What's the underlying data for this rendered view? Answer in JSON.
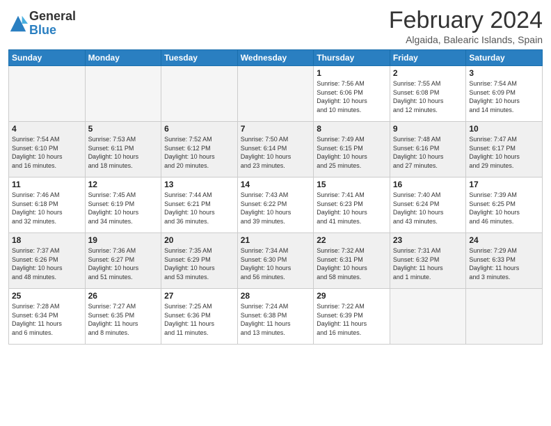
{
  "header": {
    "logo": {
      "general": "General",
      "blue": "Blue"
    },
    "title": "February 2024",
    "location": "Algaida, Balearic Islands, Spain"
  },
  "days_of_week": [
    "Sunday",
    "Monday",
    "Tuesday",
    "Wednesday",
    "Thursday",
    "Friday",
    "Saturday"
  ],
  "weeks": [
    [
      {
        "day": "",
        "info": "",
        "empty": true
      },
      {
        "day": "",
        "info": "",
        "empty": true
      },
      {
        "day": "",
        "info": "",
        "empty": true
      },
      {
        "day": "",
        "info": "",
        "empty": true
      },
      {
        "day": "1",
        "info": "Sunrise: 7:56 AM\nSunset: 6:06 PM\nDaylight: 10 hours\nand 10 minutes."
      },
      {
        "day": "2",
        "info": "Sunrise: 7:55 AM\nSunset: 6:08 PM\nDaylight: 10 hours\nand 12 minutes."
      },
      {
        "day": "3",
        "info": "Sunrise: 7:54 AM\nSunset: 6:09 PM\nDaylight: 10 hours\nand 14 minutes."
      }
    ],
    [
      {
        "day": "4",
        "info": "Sunrise: 7:54 AM\nSunset: 6:10 PM\nDaylight: 10 hours\nand 16 minutes."
      },
      {
        "day": "5",
        "info": "Sunrise: 7:53 AM\nSunset: 6:11 PM\nDaylight: 10 hours\nand 18 minutes."
      },
      {
        "day": "6",
        "info": "Sunrise: 7:52 AM\nSunset: 6:12 PM\nDaylight: 10 hours\nand 20 minutes."
      },
      {
        "day": "7",
        "info": "Sunrise: 7:50 AM\nSunset: 6:14 PM\nDaylight: 10 hours\nand 23 minutes."
      },
      {
        "day": "8",
        "info": "Sunrise: 7:49 AM\nSunset: 6:15 PM\nDaylight: 10 hours\nand 25 minutes."
      },
      {
        "day": "9",
        "info": "Sunrise: 7:48 AM\nSunset: 6:16 PM\nDaylight: 10 hours\nand 27 minutes."
      },
      {
        "day": "10",
        "info": "Sunrise: 7:47 AM\nSunset: 6:17 PM\nDaylight: 10 hours\nand 29 minutes."
      }
    ],
    [
      {
        "day": "11",
        "info": "Sunrise: 7:46 AM\nSunset: 6:18 PM\nDaylight: 10 hours\nand 32 minutes."
      },
      {
        "day": "12",
        "info": "Sunrise: 7:45 AM\nSunset: 6:19 PM\nDaylight: 10 hours\nand 34 minutes."
      },
      {
        "day": "13",
        "info": "Sunrise: 7:44 AM\nSunset: 6:21 PM\nDaylight: 10 hours\nand 36 minutes."
      },
      {
        "day": "14",
        "info": "Sunrise: 7:43 AM\nSunset: 6:22 PM\nDaylight: 10 hours\nand 39 minutes."
      },
      {
        "day": "15",
        "info": "Sunrise: 7:41 AM\nSunset: 6:23 PM\nDaylight: 10 hours\nand 41 minutes."
      },
      {
        "day": "16",
        "info": "Sunrise: 7:40 AM\nSunset: 6:24 PM\nDaylight: 10 hours\nand 43 minutes."
      },
      {
        "day": "17",
        "info": "Sunrise: 7:39 AM\nSunset: 6:25 PM\nDaylight: 10 hours\nand 46 minutes."
      }
    ],
    [
      {
        "day": "18",
        "info": "Sunrise: 7:37 AM\nSunset: 6:26 PM\nDaylight: 10 hours\nand 48 minutes."
      },
      {
        "day": "19",
        "info": "Sunrise: 7:36 AM\nSunset: 6:27 PM\nDaylight: 10 hours\nand 51 minutes."
      },
      {
        "day": "20",
        "info": "Sunrise: 7:35 AM\nSunset: 6:29 PM\nDaylight: 10 hours\nand 53 minutes."
      },
      {
        "day": "21",
        "info": "Sunrise: 7:34 AM\nSunset: 6:30 PM\nDaylight: 10 hours\nand 56 minutes."
      },
      {
        "day": "22",
        "info": "Sunrise: 7:32 AM\nSunset: 6:31 PM\nDaylight: 10 hours\nand 58 minutes."
      },
      {
        "day": "23",
        "info": "Sunrise: 7:31 AM\nSunset: 6:32 PM\nDaylight: 11 hours\nand 1 minute."
      },
      {
        "day": "24",
        "info": "Sunrise: 7:29 AM\nSunset: 6:33 PM\nDaylight: 11 hours\nand 3 minutes."
      }
    ],
    [
      {
        "day": "25",
        "info": "Sunrise: 7:28 AM\nSunset: 6:34 PM\nDaylight: 11 hours\nand 6 minutes."
      },
      {
        "day": "26",
        "info": "Sunrise: 7:27 AM\nSunset: 6:35 PM\nDaylight: 11 hours\nand 8 minutes."
      },
      {
        "day": "27",
        "info": "Sunrise: 7:25 AM\nSunset: 6:36 PM\nDaylight: 11 hours\nand 11 minutes."
      },
      {
        "day": "28",
        "info": "Sunrise: 7:24 AM\nSunset: 6:38 PM\nDaylight: 11 hours\nand 13 minutes."
      },
      {
        "day": "29",
        "info": "Sunrise: 7:22 AM\nSunset: 6:39 PM\nDaylight: 11 hours\nand 16 minutes."
      },
      {
        "day": "",
        "info": "",
        "empty": true
      },
      {
        "day": "",
        "info": "",
        "empty": true
      }
    ]
  ]
}
